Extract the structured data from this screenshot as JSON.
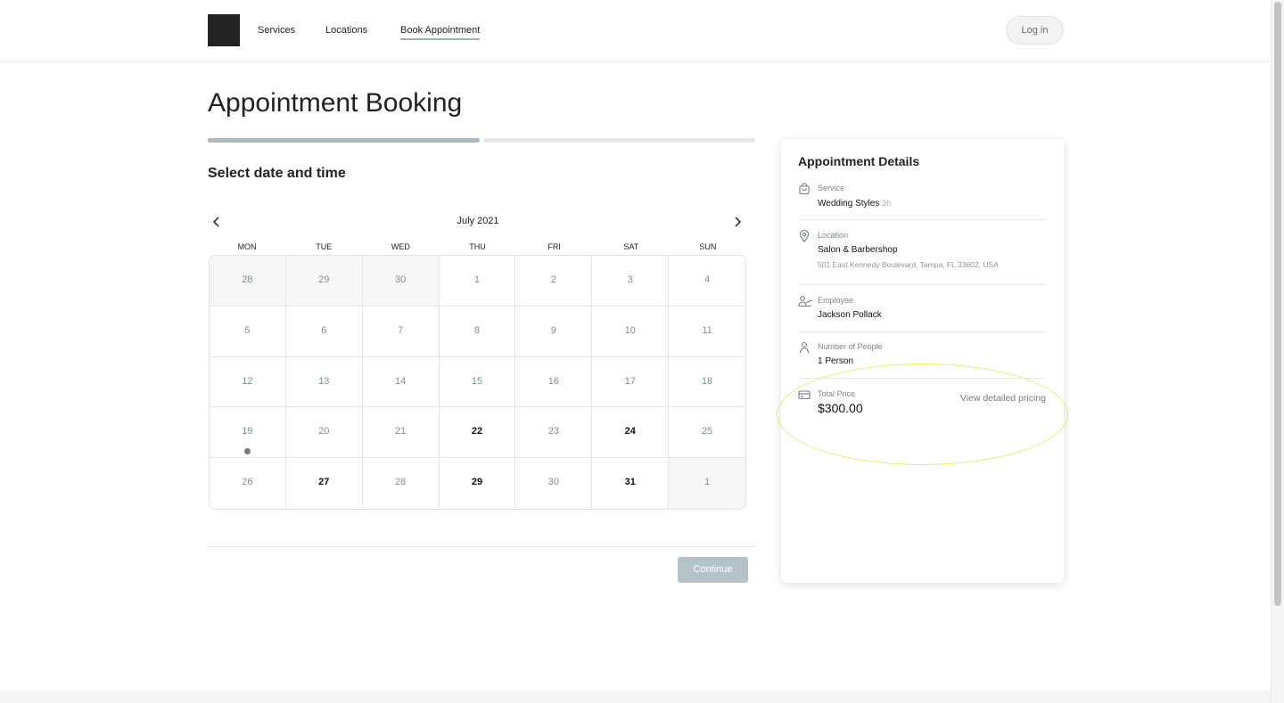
{
  "header": {
    "nav": {
      "services": "Services",
      "locations": "Locations",
      "book_appointment": "Book Appointment"
    },
    "login_label": "Log in"
  },
  "main": {
    "title": "Appointment Booking",
    "progress": {
      "current_step": 1,
      "total_steps": 2
    },
    "section_title": "Select date and time",
    "calendar": {
      "month_label": "July 2021",
      "prev_icon": "chevron-left-icon",
      "next_icon": "chevron-right-icon",
      "weekdays": [
        "MON",
        "TUE",
        "WED",
        "THU",
        "FRI",
        "SAT",
        "SUN"
      ],
      "days": [
        {
          "label": "28",
          "outside": true
        },
        {
          "label": "29",
          "outside": true
        },
        {
          "label": "30",
          "outside": true
        },
        {
          "label": "1"
        },
        {
          "label": "2"
        },
        {
          "label": "3"
        },
        {
          "label": "4"
        },
        {
          "label": "5"
        },
        {
          "label": "6"
        },
        {
          "label": "7"
        },
        {
          "label": "8"
        },
        {
          "label": "9"
        },
        {
          "label": "10"
        },
        {
          "label": "11"
        },
        {
          "label": "12"
        },
        {
          "label": "13"
        },
        {
          "label": "14"
        },
        {
          "label": "15"
        },
        {
          "label": "16"
        },
        {
          "label": "17"
        },
        {
          "label": "18"
        },
        {
          "label": "19",
          "today": true
        },
        {
          "label": "20"
        },
        {
          "label": "21"
        },
        {
          "label": "22",
          "available": true
        },
        {
          "label": "23"
        },
        {
          "label": "24",
          "available": true
        },
        {
          "label": "25"
        },
        {
          "label": "26"
        },
        {
          "label": "27",
          "available": true
        },
        {
          "label": "28"
        },
        {
          "label": "29",
          "available": true
        },
        {
          "label": "30"
        },
        {
          "label": "31",
          "available": true
        },
        {
          "label": "1",
          "outside": true
        }
      ]
    },
    "continue_label": "Continue"
  },
  "details": {
    "title": "Appointment Details",
    "service": {
      "label": "Service",
      "value": "Wedding Styles",
      "duration": "3h",
      "icon": "bag-icon"
    },
    "location": {
      "label": "Location",
      "value": "Salon & Barbershop",
      "address": "501 East Kennedy Boulevard, Tampa, FL 33602, USA",
      "icon": "map-pin-icon"
    },
    "employee": {
      "label": "Employee",
      "value": "Jackson Pollack",
      "icon": "employee-icon"
    },
    "people": {
      "label": "Number of People",
      "value": "1 Person",
      "icon": "person-icon"
    },
    "price": {
      "label": "Total Price",
      "value": "$300.00",
      "link": "View detailed pricing",
      "icon": "credit-card-icon"
    }
  },
  "colors": {
    "accent": "#a9b9c0",
    "continue_disabled": "#b3c4c9",
    "highlight": "#efe86a"
  }
}
